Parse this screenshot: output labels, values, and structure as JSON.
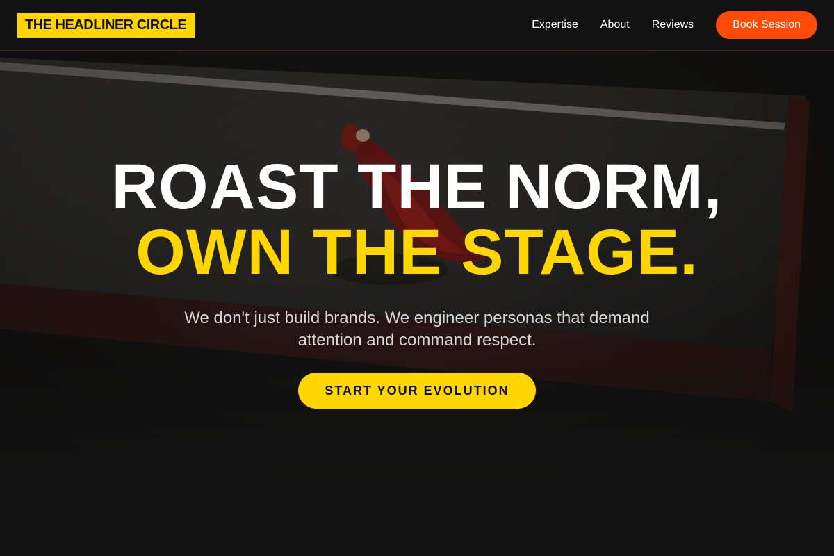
{
  "header": {
    "logo_text": "THE HEADLINER CIRCLE",
    "nav": {
      "expertise": "Expertise",
      "about": "About",
      "reviews": "Reviews"
    },
    "cta_label": "Book Session"
  },
  "hero": {
    "headline_line1": "ROAST THE NORM,",
    "headline_line2": "OWN THE STAGE.",
    "subtitle": "We don't just build brands. We engineer personas that demand attention and command respect.",
    "cta_label": "START YOUR EVOLUTION",
    "background_image": "performer-on-stage-photo"
  },
  "colors": {
    "accent_yellow": "#ffd600",
    "accent_orange": "#ff4a0a",
    "background": "#121212",
    "text_white": "#ffffff"
  }
}
